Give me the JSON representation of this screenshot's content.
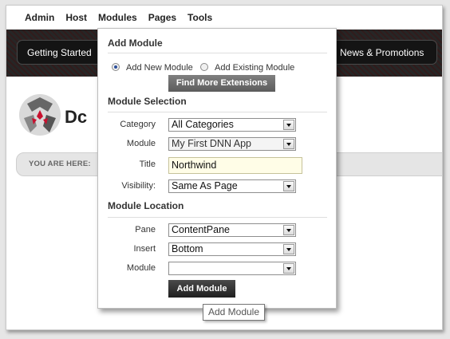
{
  "top_menu": [
    "Admin",
    "Host",
    "Modules",
    "Pages",
    "Tools"
  ],
  "banner": {
    "left_button": "Getting Started",
    "right_button": "News & Promotions"
  },
  "logo_text": "Dc",
  "breadcrumb_label": "YOU ARE HERE:",
  "panel": {
    "add_module_heading": "Add Module",
    "radio_new": "Add New Module",
    "radio_existing": "Add Existing Module",
    "find_button": "Find More Extensions",
    "selection_heading": "Module Selection",
    "category_label": "Category",
    "category_value": "All Categories",
    "module_label": "Module",
    "module_value": "My First DNN App",
    "title_label": "Title",
    "title_value": "Northwind",
    "visibility_label": "Visibility:",
    "visibility_value": "Same As Page",
    "location_heading": "Module Location",
    "pane_label": "Pane",
    "pane_value": "ContentPane",
    "insert_label": "Insert",
    "insert_value": "Bottom",
    "module2_label": "Module",
    "module2_value": "",
    "add_button": "Add Module"
  },
  "tooltip": "Add Module",
  "colors": {
    "banner_bg": "#2a2a2a",
    "button_dark": "#1f1f1f",
    "input_highlight": "#fffde7",
    "radio_selected": "#2b4f9a"
  }
}
